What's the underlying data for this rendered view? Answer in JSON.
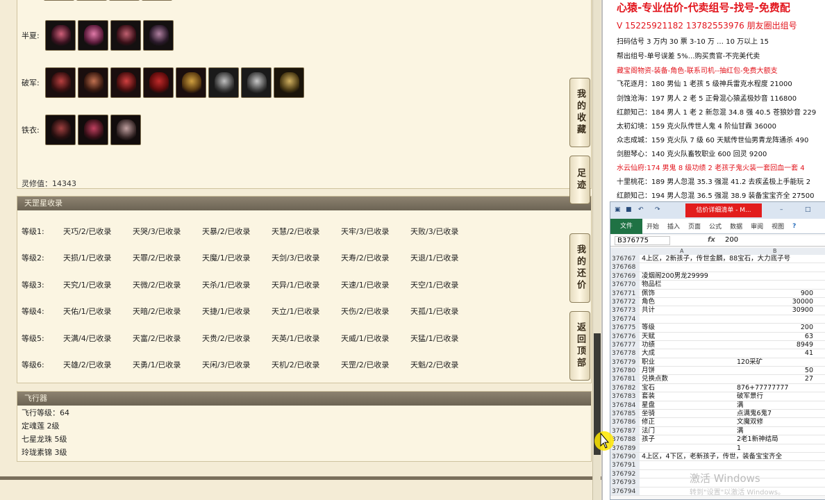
{
  "equip": {
    "rows": [
      {
        "label": "半夏:",
        "slots": 4
      },
      {
        "label": "破军:",
        "slots": 8
      },
      {
        "label": "铁衣:",
        "slots": 3
      }
    ],
    "lingxiu": "灵修值：14343"
  },
  "tiangang": {
    "title": "天罡星收录",
    "levels": [
      {
        "label": "等级1:",
        "items": [
          "天巧/2/已收录",
          "天哭/3/已收录",
          "天暴/2/已收录",
          "天慧/2/已收录",
          "天牢/3/已收录",
          "天败/3/已收录"
        ]
      },
      {
        "label": "等级2:",
        "items": [
          "天损/1/已收录",
          "天罪/2/已收录",
          "天魔/1/已收录",
          "天剑/3/已收录",
          "天寿/2/已收录",
          "天退/1/已收录"
        ]
      },
      {
        "label": "等级3:",
        "items": [
          "天究/1/已收录",
          "天微/2/已收录",
          "天杀/1/已收录",
          "天异/1/已收录",
          "天速/1/已收录",
          "天空/1/已收录"
        ]
      },
      {
        "label": "等级4:",
        "items": [
          "天佑/1/已收录",
          "天暗/2/已收录",
          "天捷/1/已收录",
          "天立/1/已收录",
          "天伤/2/已收录",
          "天孤/1/已收录"
        ]
      },
      {
        "label": "等级5:",
        "items": [
          "天满/4/已收录",
          "天富/2/已收录",
          "天贵/2/已收录",
          "天英/1/已收录",
          "天威/1/已收录",
          "天猛/1/已收录"
        ]
      },
      {
        "label": "等级6:",
        "items": [
          "天雄/2/已收录",
          "天勇/1/已收录",
          "天闲/3/已收录",
          "天机/2/已收录",
          "天罡/2/已收录",
          "天魁/2/已收录"
        ]
      }
    ]
  },
  "flyer": {
    "title": "飞行器",
    "lines": [
      "飞行等级：64",
      "定魂莲   2级",
      "七星龙珠   5级",
      "玲珑素锦   3级"
    ]
  },
  "side_buttons": [
    "我的收藏",
    "足迹",
    "我的还价",
    "返回顶部"
  ],
  "doc": {
    "title": "心猿-专业估价-代卖组号-找号-免费配",
    "phone": "V 15225921182   13782553976 朋友圈出组号",
    "lines": [
      {
        "text": "扫码估号 3 万内 30 票 3-10 万 … 10 万以上 15",
        "red": false
      },
      {
        "text": "帮出组号-单号误差 5%…购买贵官-不完美代卖",
        "red": false
      },
      {
        "text": "藏宝阁物资-装备-角色-联系司机--抽红包-免费大额支",
        "red": true
      },
      {
        "text": "飞花逐月：180 男仙 1 老孩 5 级神兵雷克水程度 21000",
        "red": false
      },
      {
        "text": "剑蚀沧海：197 男人 2 老 5 正骨混心猿孟极妙音 116800",
        "red": false
      },
      {
        "text": "红颜知己：184 男人 1 老 2 新忽混 34.8 强 40.5 苍狼妙音 229",
        "red": false
      },
      {
        "text": "太初幻境：159 克火队传世人鬼 4 阶仙甘霖 36000",
        "red": false
      },
      {
        "text": "众志成城：159 克火队 7 级 60 天赋传世仙男青龙阵通杀 490",
        "red": false
      },
      {
        "text": "剑胆琴心：140 克火队畜牧职业 600 回灵 9200",
        "red": false
      },
      {
        "text": "水云仙府:174 男鬼 8 级功绩 2 老孩子鬼火装一套回血一套 4",
        "red": true
      },
      {
        "text": "十里桃花：189 男人忽混 35.3 强混 41.2 去疾孟极上手能玩 2",
        "red": false
      },
      {
        "text": "红颜知己：194 男人忽混 36.5 强混 38.9 装备宝宝齐全 27500",
        "red": false
      }
    ]
  },
  "excel": {
    "title_tab": "估价详细清单 - M...",
    "ribbon_file": "文件",
    "ribbon_tabs": [
      "开始",
      "插入",
      "页面",
      "公式",
      "数据",
      "审阅",
      "视图"
    ],
    "name_box": "B376775",
    "fx": "fx",
    "formula": "200",
    "col_a": "A",
    "col_b": "B",
    "rows": [
      {
        "n": "376767",
        "a": "4上区，2新孩子，传世金麟，88宝石，大力底子号",
        "b": ""
      },
      {
        "n": "376768",
        "a": "",
        "b": ""
      },
      {
        "n": "376769",
        "a": "凌烟阁200男龙29999",
        "b": ""
      },
      {
        "n": "376770",
        "a": "物品栏",
        "b": ""
      },
      {
        "n": "376771",
        "a": "佩饰",
        "b": "900",
        "num": true
      },
      {
        "n": "376772",
        "a": "角色",
        "b": "30000",
        "num": true
      },
      {
        "n": "376773",
        "a": "共计",
        "b": "30900",
        "num": true
      },
      {
        "n": "376774",
        "a": "",
        "b": ""
      },
      {
        "n": "376775",
        "a": "等级",
        "b": "200",
        "num": true
      },
      {
        "n": "376776",
        "a": "天赋",
        "b": "63",
        "num": true
      },
      {
        "n": "376777",
        "a": "功绩",
        "b": "8949",
        "num": true
      },
      {
        "n": "376778",
        "a": "大成",
        "b": "41",
        "num": true
      },
      {
        "n": "376779",
        "a": "职业",
        "b": "120采矿"
      },
      {
        "n": "376780",
        "a": "月饼",
        "b": "50",
        "num": true
      },
      {
        "n": "376781",
        "a": "兑换点数",
        "b": "27",
        "num": true
      },
      {
        "n": "376782",
        "a": "宝石",
        "b": "876+77777777"
      },
      {
        "n": "376783",
        "a": "套装",
        "b": "破军景行"
      },
      {
        "n": "376784",
        "a": "星盘",
        "b": "满"
      },
      {
        "n": "376785",
        "a": "坐骑",
        "b": "点满鬼6鬼7"
      },
      {
        "n": "376786",
        "a": "修正",
        "b": "文魔双修"
      },
      {
        "n": "376787",
        "a": "法门",
        "b": "满"
      },
      {
        "n": "376788",
        "a": "孩子",
        "b": "2老1新神结局"
      },
      {
        "n": "376789",
        "a": "",
        "b": "1"
      },
      {
        "n": "376790",
        "a": "4上区，4下区，老新孩子，传世，装备宝宝齐全",
        "b": ""
      },
      {
        "n": "376791",
        "a": "",
        "b": ""
      },
      {
        "n": "376792",
        "a": "",
        "b": ""
      },
      {
        "n": "376793",
        "a": "",
        "b": ""
      },
      {
        "n": "376794",
        "a": "",
        "b": ""
      }
    ]
  },
  "watermark": {
    "line1": "激活 Windows",
    "line2": "转到\"设置\"以激活 Windows。"
  }
}
